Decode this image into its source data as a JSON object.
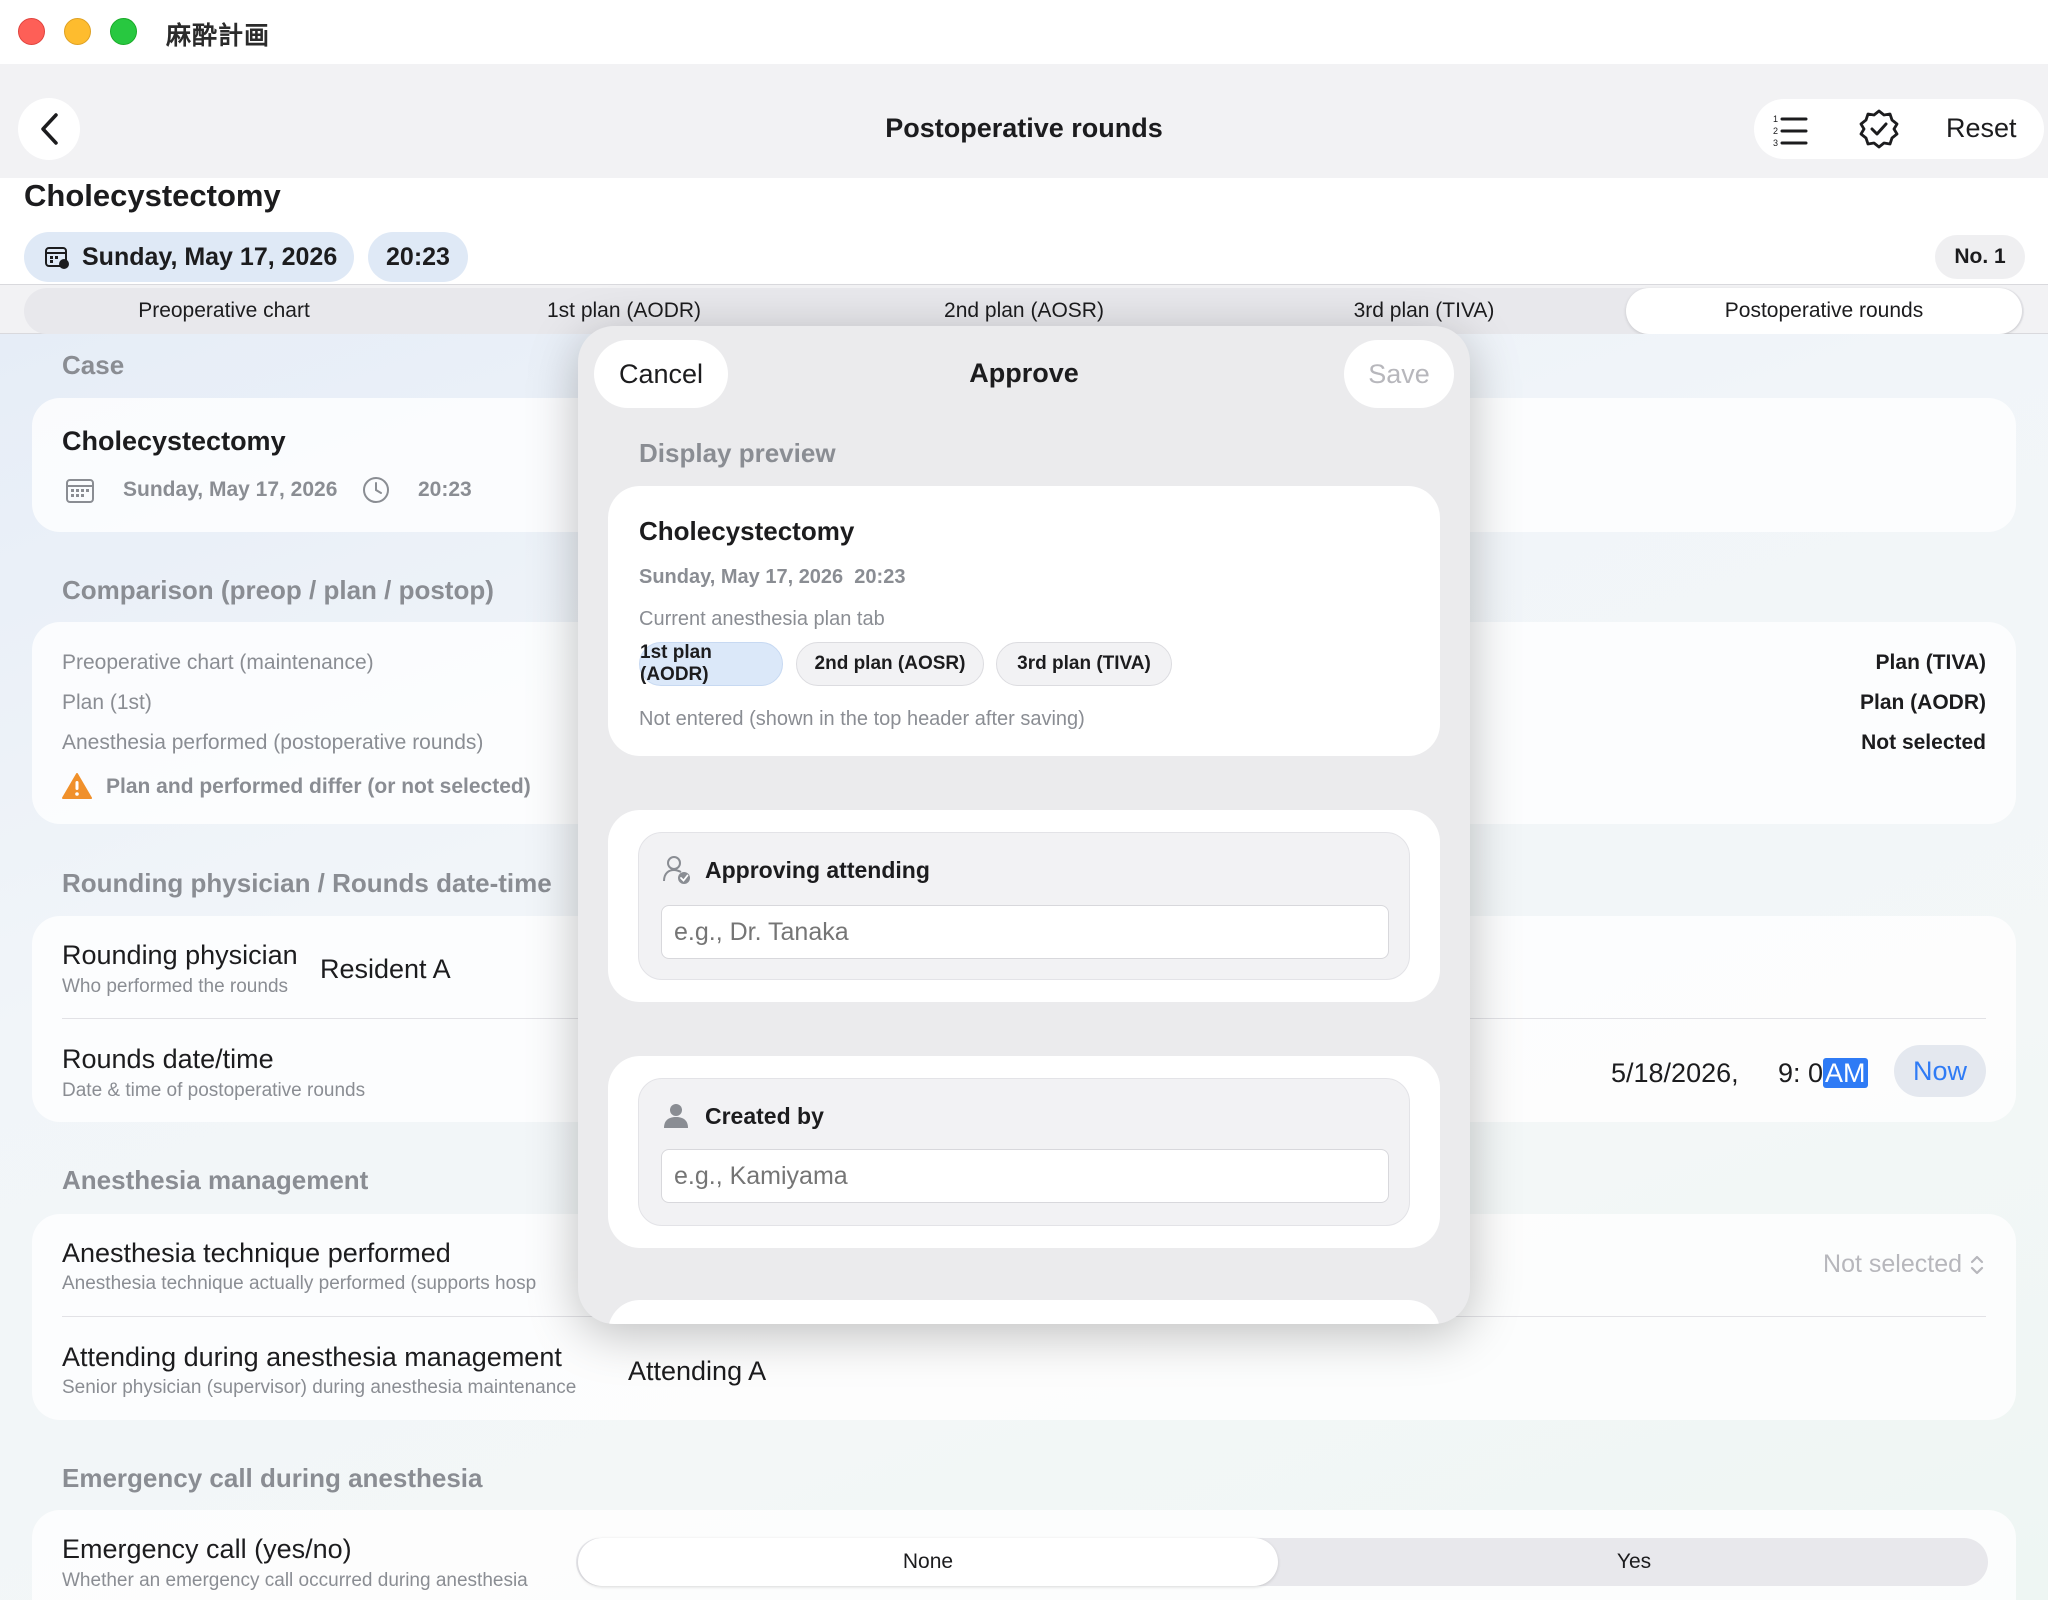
{
  "window": {
    "title": "麻酔計画"
  },
  "nav": {
    "title": "Postoperative rounds",
    "reset_label": "Reset"
  },
  "header": {
    "title": "Cholecystectomy",
    "date": "Sunday, May 17, 2026",
    "time": "20:23",
    "number": "No. 1"
  },
  "tabs": [
    {
      "label": "Preoperative chart",
      "active": false
    },
    {
      "label": "1st plan (AODR)",
      "active": false
    },
    {
      "label": "2nd plan (AOSR)",
      "active": false
    },
    {
      "label": "3rd plan (TIVA)",
      "active": false
    },
    {
      "label": "Postoperative rounds",
      "active": true
    }
  ],
  "case": {
    "section": "Case",
    "title": "Cholecystectomy",
    "date": "Sunday, May 17, 2026",
    "time": "20:23"
  },
  "comparison": {
    "section": "Comparison (preop / plan / postop)",
    "rows": [
      {
        "label": "Preoperative chart (maintenance)",
        "value": "Plan (TIVA)"
      },
      {
        "label": "Plan (1st)",
        "value": "Plan (AODR)"
      },
      {
        "label": "Anesthesia performed (postoperative rounds)",
        "value": "Not selected"
      }
    ],
    "warning": "Plan and performed differ (or not selected)"
  },
  "rounding": {
    "section": "Rounding physician / Rounds date-time",
    "physician_label": "Rounding physician",
    "physician_sub": "Who performed the rounds",
    "physician_value": "Resident A",
    "datetime_label": "Rounds date/time",
    "datetime_sub": "Date & time of postoperative rounds",
    "date_value": "5/18/2026,",
    "time_value": "9: 0",
    "ampm": "AM",
    "now_label": "Now"
  },
  "management": {
    "section": "Anesthesia management",
    "technique_label": "Anesthesia technique performed",
    "technique_sub": "Anesthesia technique actually performed (supports hosp",
    "technique_value": "Not selected",
    "attending_label": "Attending during anesthesia management",
    "attending_sub": "Senior physician (supervisor) during anesthesia maintenance",
    "attending_value": "Attending A"
  },
  "emergency": {
    "section": "Emergency call during anesthesia",
    "label": "Emergency call (yes/no)",
    "sub": "Whether an emergency call occurred during anesthesia",
    "options": [
      "None",
      "Yes"
    ],
    "selected": "None"
  },
  "modal": {
    "cancel_label": "Cancel",
    "title": "Approve",
    "save_label": "Save",
    "preview_section": "Display preview",
    "preview": {
      "title": "Cholecystectomy",
      "datetime": "Sunday, May 17, 2026  20:23",
      "tab_caption": "Current anesthesia plan tab",
      "plans": [
        "1st plan (AODR)",
        "2nd plan (AOSR)",
        "3rd plan (TIVA)"
      ],
      "selected_plan": "1st plan (AODR)",
      "note": "Not entered (shown in the top header after saving)"
    },
    "approving": {
      "label": "Approving attending",
      "placeholder": "e.g., Dr. Tanaka"
    },
    "created_by": {
      "label": "Created by",
      "placeholder": "e.g., Kamiyama"
    }
  },
  "colors": {
    "accent": "#2f7bf5",
    "warning": "#f0902b",
    "selected_chip": "#dbe8f9"
  }
}
